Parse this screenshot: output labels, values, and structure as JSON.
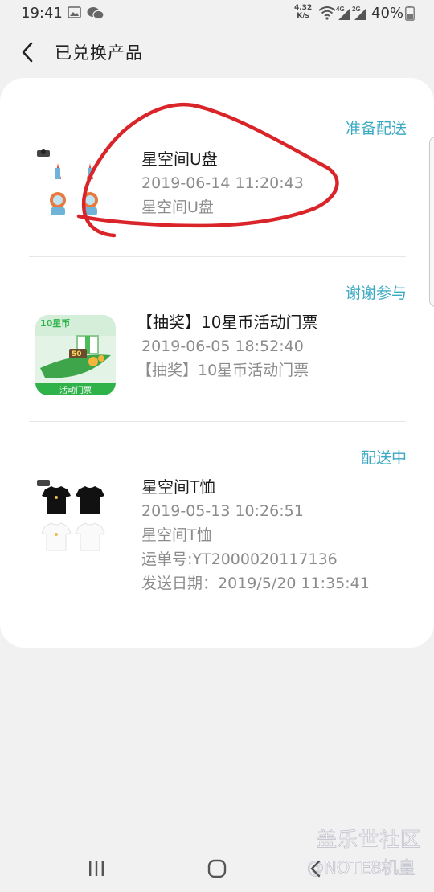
{
  "status_bar": {
    "time": "19:41",
    "net_speed_value": "4.32",
    "net_speed_unit": "K/s",
    "sig1": "4G",
    "sig2": "2G",
    "battery": "40%"
  },
  "header": {
    "title": "已兑换产品"
  },
  "orders": [
    {
      "status": "准备配送",
      "name": "星空间U盘",
      "datetime": "2019-06-14 11:20:43",
      "desc": "星空间U盘"
    },
    {
      "status": "谢谢参与",
      "name": "【抽奖】10星币活动门票",
      "datetime": "2019-06-05 18:52:40",
      "desc": "【抽奖】10星币活动门票",
      "thumb_title": "10星币",
      "thumb_badge": "50",
      "thumb_footer": "活动门票"
    },
    {
      "status": "配送中",
      "name": "星空间T恤",
      "datetime": "2019-05-13 10:26:51",
      "desc": "星空间T恤",
      "tracking": "运单号:YT2000020117136",
      "ship_date": "发送日期：2019/5/20 11:35:41"
    }
  ],
  "watermark": {
    "line1": "盖乐世社区",
    "line2": "@NOTE8机皇"
  },
  "colors": {
    "status_accent": "#3aa9c2",
    "annotation_red": "#d9252a",
    "ticket_green": "#2fb24a"
  },
  "icons": [
    "gallery-icon",
    "wechat-icon",
    "wifi-icon",
    "signal-icon",
    "battery-icon",
    "back-arrow-icon",
    "recents-icon",
    "home-icon",
    "back-nav-icon"
  ]
}
